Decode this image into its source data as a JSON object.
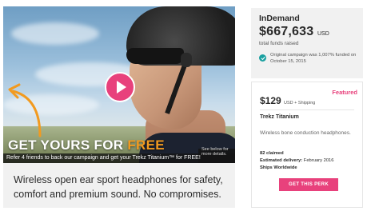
{
  "video": {
    "headline_prefix": "GET YOURS FOR ",
    "headline_free": "FREE",
    "refer_text": "Refer 4 friends to back our campaign and get your Trekz Titanium™ for FREE!",
    "see_more": "See below for more details.",
    "play_icon": "play-icon",
    "arrow_icon": "curved-arrow-icon"
  },
  "tagline": "Wireless open ear sport headphones for safety, comfort and premium sound. No compromises.",
  "funding": {
    "brand": "InDemand",
    "amount": "$667,633",
    "currency": "USD",
    "total_label": "total funds raised",
    "note": "Original campaign was 1,007% funded on October 15, 2015"
  },
  "perk": {
    "featured": "Featured",
    "price": "$129",
    "price_sub": "USD + Shipping",
    "name": "Trekz Titanium",
    "description": "Wireless bone conduction headphones.",
    "claimed": "82 claimed",
    "delivery_label": "Estimated delivery:",
    "delivery_value": "February 2016",
    "ships": "Ships Worldwide",
    "button_label": "GET THIS PERK"
  },
  "colors": {
    "accent": "#e8417c",
    "free_orange": "#f29a1f",
    "check_teal": "#1aa0a0",
    "panel_gray": "#f1f1f1"
  }
}
